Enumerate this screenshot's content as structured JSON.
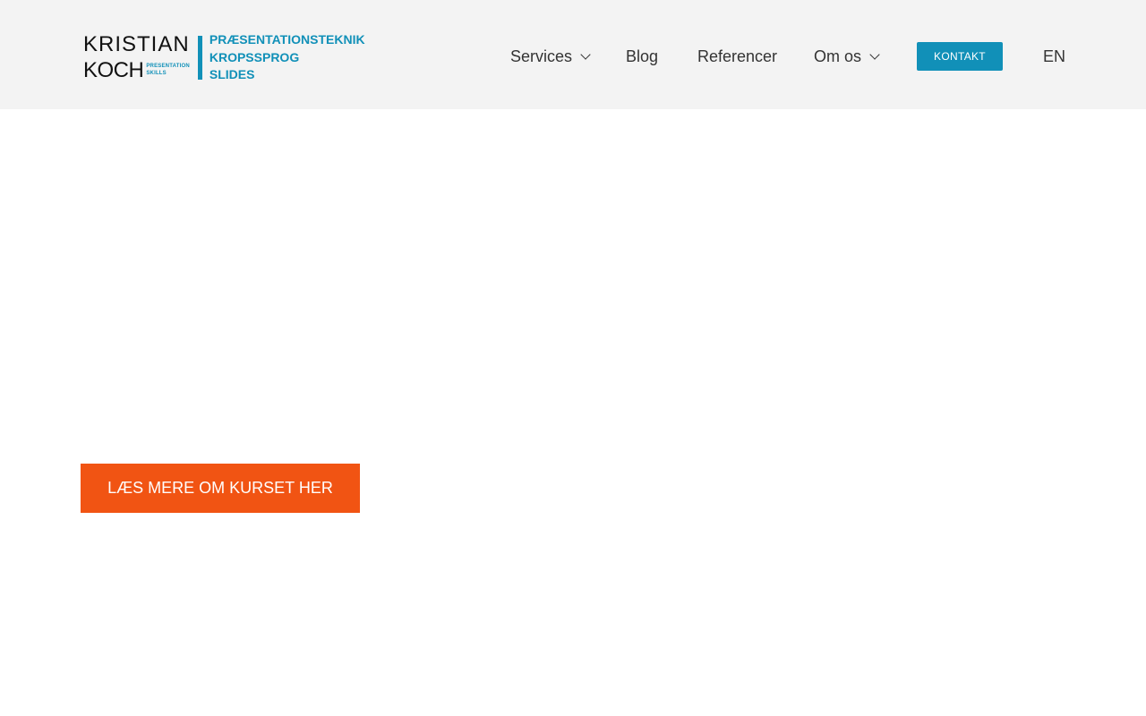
{
  "logo": {
    "name_line1": "KRISTIAN",
    "name_line2": "KOCH",
    "subtitle_line1": "PRESENTATION",
    "subtitle_line2": "SKILLS",
    "taglines": [
      "PRÆSENTATIONSTEKNIK",
      "KROPSSPROG",
      "SLIDES"
    ]
  },
  "nav": {
    "items": [
      {
        "label": "Services",
        "has_dropdown": true
      },
      {
        "label": "Blog",
        "has_dropdown": false
      },
      {
        "label": "Referencer",
        "has_dropdown": false
      },
      {
        "label": "Om os",
        "has_dropdown": true
      }
    ],
    "contact_button": "KONTAKT",
    "language": "EN"
  },
  "main": {
    "cta_button": "LÆS MERE OM KURSET HER"
  },
  "colors": {
    "brand_blue": "#1190b8",
    "cta_orange": "#f15413",
    "header_bg": "#f3f3f3"
  }
}
